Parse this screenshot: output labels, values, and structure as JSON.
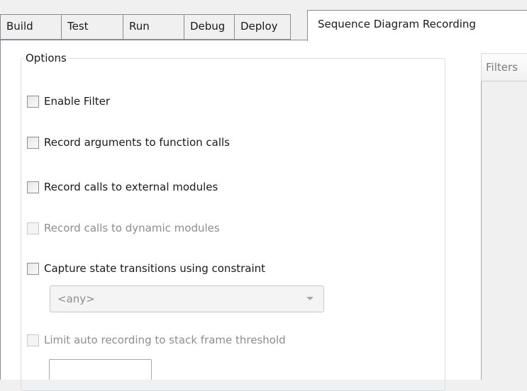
{
  "tabs": [
    {
      "label": "Build"
    },
    {
      "label": "Test"
    },
    {
      "label": "Run"
    },
    {
      "label": "Debug"
    },
    {
      "label": "Deploy"
    },
    {
      "label": "Sequence Diagram Recording",
      "active": true
    }
  ],
  "options": {
    "group_label": "Options",
    "enable_filter": {
      "label": "Enable Filter",
      "checked": false,
      "enabled": true
    },
    "record_arguments": {
      "label": "Record arguments to function calls",
      "checked": false,
      "enabled": true
    },
    "record_external": {
      "label": "Record calls to external modules",
      "checked": false,
      "enabled": true
    },
    "record_dynamic": {
      "label": "Record calls to dynamic modules",
      "checked": false,
      "enabled": false
    },
    "capture_state": {
      "label": "Capture state transitions using constraint",
      "checked": false,
      "enabled": true
    },
    "constraint_select": {
      "value": "<any>",
      "enabled": false
    },
    "limit_recording": {
      "label": "Limit auto recording to stack frame threshold",
      "checked": false,
      "enabled": false
    },
    "threshold_value": ""
  },
  "filters": {
    "header": "Filters"
  }
}
